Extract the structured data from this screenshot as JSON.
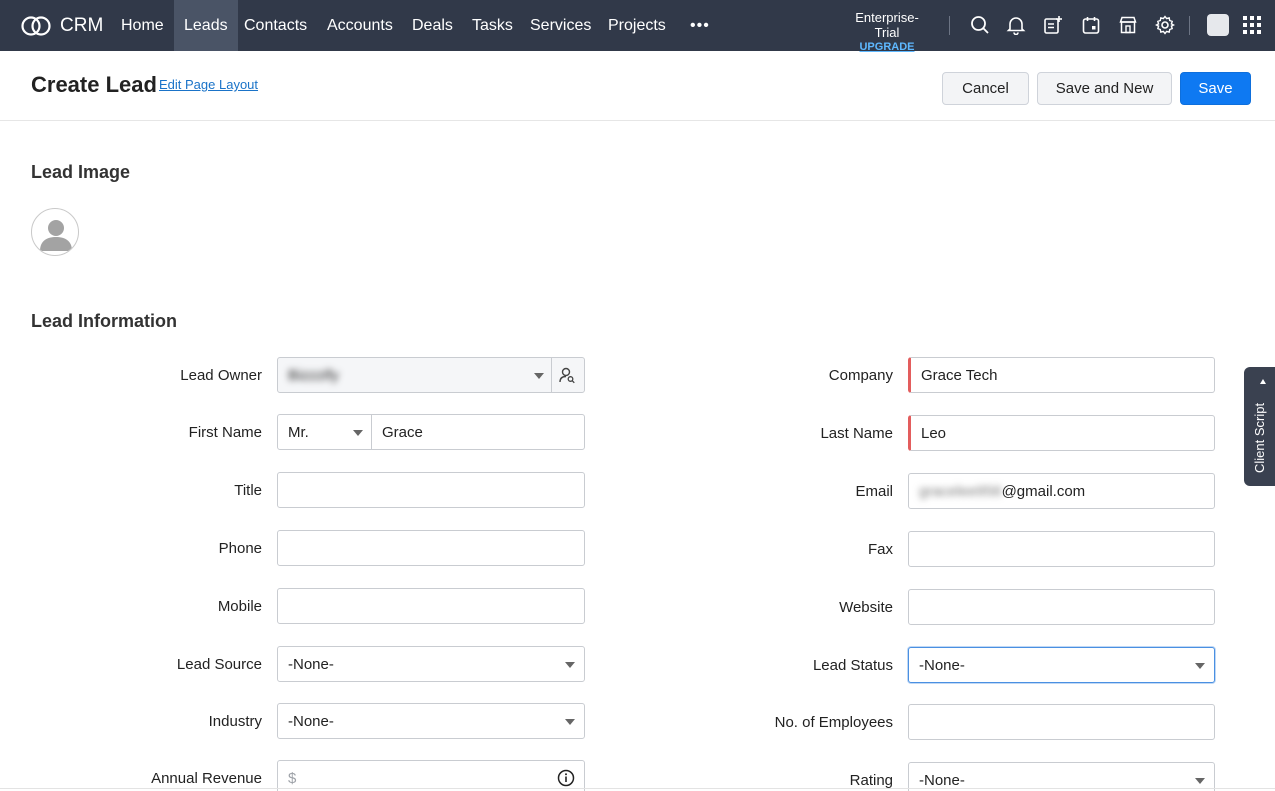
{
  "nav": {
    "logo_text": "CRM",
    "tabs": [
      {
        "label": "Home"
      },
      {
        "label": "Leads"
      },
      {
        "label": "Contacts"
      },
      {
        "label": "Accounts"
      },
      {
        "label": "Deals"
      },
      {
        "label": "Tasks"
      },
      {
        "label": "Services"
      },
      {
        "label": "Projects"
      }
    ],
    "more": "•••",
    "plan": "Enterprise-Trial",
    "upgrade": "UPGRADE"
  },
  "header": {
    "title": "Create Lead",
    "edit_layout": "Edit Page Layout",
    "cancel": "Cancel",
    "save_new": "Save and New",
    "save": "Save"
  },
  "sections": {
    "image_title": "Lead Image",
    "info_title": "Lead Information"
  },
  "form": {
    "lead_owner": {
      "label": "Lead Owner",
      "value": "Bizzzify"
    },
    "first_name": {
      "label": "First Name",
      "salutation": "Mr.",
      "value": "Grace"
    },
    "title": {
      "label": "Title",
      "value": ""
    },
    "phone": {
      "label": "Phone",
      "value": ""
    },
    "mobile": {
      "label": "Mobile",
      "value": ""
    },
    "lead_source": {
      "label": "Lead Source",
      "value": "-None-"
    },
    "industry": {
      "label": "Industry",
      "value": "-None-"
    },
    "annual_revenue": {
      "label": "Annual Revenue",
      "placeholder": "$"
    },
    "company": {
      "label": "Company",
      "value": "Grace Tech"
    },
    "last_name": {
      "label": "Last Name",
      "value": "Leo"
    },
    "email": {
      "label": "Email",
      "value_hidden": "gracelee956",
      "value_domain": "@gmail.com"
    },
    "fax": {
      "label": "Fax",
      "value": ""
    },
    "website": {
      "label": "Website",
      "value": ""
    },
    "lead_status": {
      "label": "Lead Status",
      "value": "-None-"
    },
    "employees": {
      "label": "No. of Employees",
      "value": ""
    },
    "rating": {
      "label": "Rating",
      "value": "-None-"
    }
  },
  "client_script": "Client Script",
  "colors": {
    "nav_bg": "#313949",
    "active_tab": "#4a5466",
    "primary": "#0e79f2",
    "required": "#e35d5d",
    "link": "#1a73c8"
  },
  "icons": [
    "crm-logo-icon",
    "search-icon",
    "bell-icon",
    "add-note-icon",
    "calendar-icon",
    "marketplace-icon",
    "gear-icon",
    "apps-grid-icon",
    "user-lookup-icon",
    "info-icon",
    "default-avatar-icon"
  ]
}
